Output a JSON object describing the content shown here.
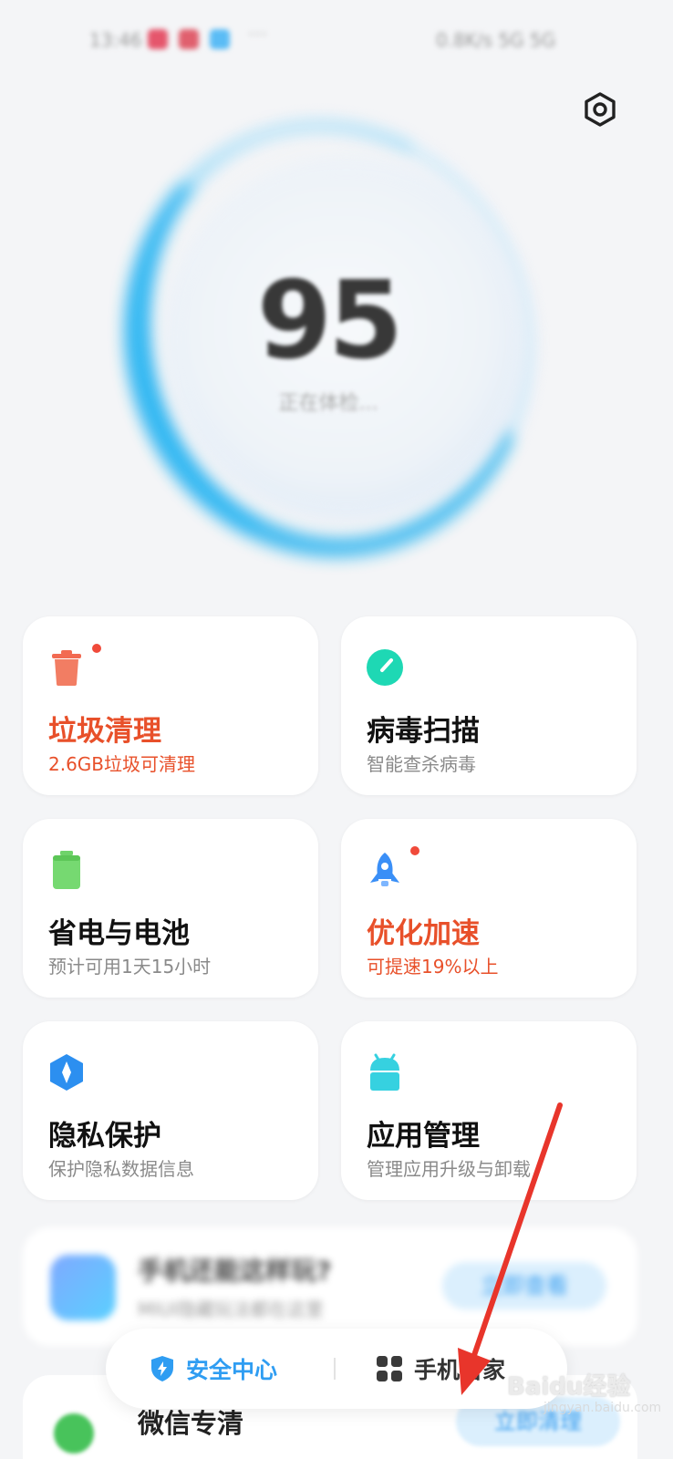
{
  "status_bar": {
    "time": "13:46",
    "right": "0.8K/s 5G 5G"
  },
  "icons": {
    "settings": "hexagon-gear-icon",
    "trash": "trash-can-icon",
    "virus": "scanner-dial-icon",
    "battery": "battery-icon",
    "rocket": "rocket-icon",
    "privacy": "shield-privacy-icon",
    "apps": "android-icon",
    "security": "shield-bolt-icon",
    "grid": "four-squares-icon"
  },
  "score": {
    "value": "95",
    "status": "正在体检..."
  },
  "cards": [
    {
      "title": "垃圾清理",
      "subtitle": "2.6GB垃圾可清理",
      "alert": true
    },
    {
      "title": "病毒扫描",
      "subtitle": "智能查杀病毒",
      "alert": false
    },
    {
      "title": "省电与电池",
      "subtitle": "预计可用1天15小时",
      "alert": false
    },
    {
      "title": "优化加速",
      "subtitle": "可提速19%以上",
      "alert": true
    },
    {
      "title": "隐私保护",
      "subtitle": "保护隐私数据信息",
      "alert": false
    },
    {
      "title": "应用管理",
      "subtitle": "管理应用升级与卸载",
      "alert": false
    }
  ],
  "promo": {
    "title": "手机还能这样玩?",
    "subtitle": "MIUI隐藏玩法都在这里",
    "button": "立即查看"
  },
  "wechat": {
    "title": "微信专清",
    "button": "立即清理"
  },
  "bottom_bar": {
    "security_center": "安全中心",
    "phone_manager": "手机管家"
  },
  "watermark": {
    "text": "Baidu经验",
    "sub": "jingyan.baidu.com"
  },
  "colors": {
    "accent_blue": "#2f9df2",
    "alert_orange": "#e8502a",
    "trash_red": "#f26a52",
    "virus_teal": "#1ed8b4",
    "battery_green": "#6fd36a",
    "rocket_blue": "#3a8ff7",
    "privacy_blue": "#2c8ff0",
    "apps_cyan": "#36d1e0",
    "arrow_red": "#e8352b"
  }
}
